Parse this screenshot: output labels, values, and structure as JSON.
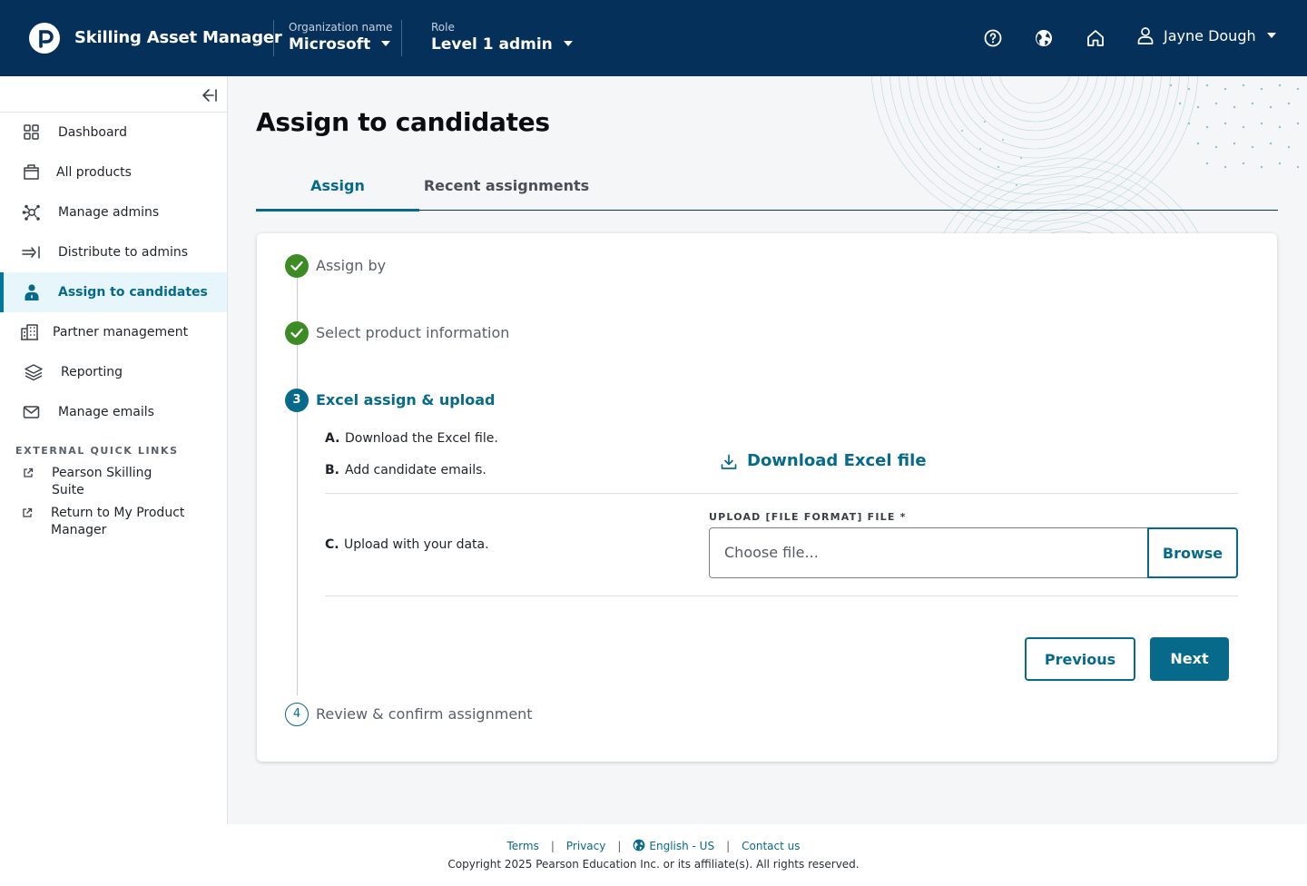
{
  "header": {
    "app_title": "Skilling Asset Manager",
    "org_label": "Organization name",
    "org_value": "Microsoft",
    "role_label": "Role",
    "role_value": "Level 1 admin",
    "user_name": "Jayne Dough",
    "icons": [
      "help-icon",
      "globe-icon",
      "home-icon",
      "user-icon"
    ]
  },
  "sidebar": {
    "items": [
      {
        "label": "Dashboard",
        "icon": "grid-icon"
      },
      {
        "label": "All products",
        "icon": "box-icon"
      },
      {
        "label": "Manage admins",
        "icon": "network-icon"
      },
      {
        "label": "Distribute to admins",
        "icon": "arrow-right-bar-icon"
      },
      {
        "label": "Assign to candidates",
        "icon": "person-icon",
        "active": true
      },
      {
        "label": "Partner management",
        "icon": "building-icon"
      },
      {
        "label": "Reporting",
        "icon": "layers-icon"
      },
      {
        "label": "Manage emails",
        "icon": "mail-icon"
      }
    ],
    "external_title": "EXTERNAL QUICK LINKS",
    "external_links": [
      {
        "line1": "Pearson Skilling",
        "line2": "Suite"
      },
      {
        "line1": "Return to My Product",
        "line2": "Manager"
      }
    ]
  },
  "main": {
    "title": "Assign to candidates",
    "tabs": [
      "Assign",
      "Recent assignments"
    ],
    "steps": {
      "s1": "Assign by",
      "s2": "Select product information",
      "s3_num": "3",
      "s3": "Excel assign & upload",
      "s4_num": "4",
      "s4": "Review & confirm assignment"
    },
    "substeps": {
      "a_key": "A.",
      "a": "Download the Excel file.",
      "b_key": "B.",
      "b": "Add candidate emails.",
      "c_key": "C.",
      "c": "Upload with your data."
    },
    "download_label": "Download Excel file",
    "upload_label": "UPLOAD [FILE FORMAT] FILE *",
    "file_placeholder": "Choose file...",
    "browse_label": "Browse",
    "previous_label": "Previous",
    "next_label": "Next"
  },
  "footer": {
    "terms": "Terms",
    "privacy": "Privacy",
    "language": "English - US",
    "contact": "Contact us",
    "copyright": "Copyright 2025 Pearson Education Inc. or its affiliate(s). All rights reserved."
  },
  "colors": {
    "header_bg": "#05305a",
    "accent": "#076a8a",
    "success": "#3d8b24",
    "active_bg": "#e6f6fb"
  }
}
